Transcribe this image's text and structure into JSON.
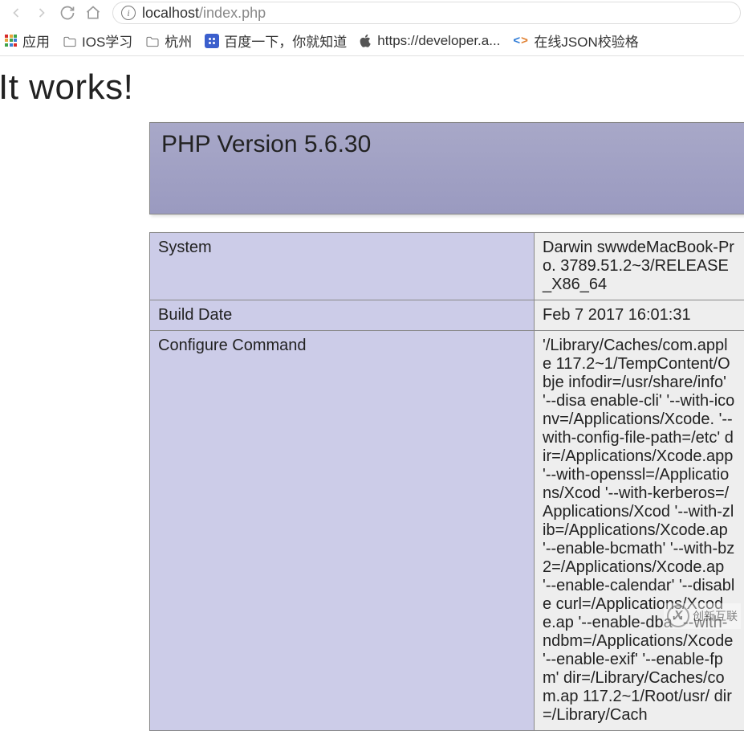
{
  "url": {
    "host": "localhost",
    "path": "/index.php"
  },
  "bookmarks": {
    "apps": "应用",
    "ios": "IOS学习",
    "hz": "杭州",
    "baidu": "百度一下，你就知道",
    "apple": "https://developer.a...",
    "json": "在线JSON校验格"
  },
  "page": {
    "heading": "It works!"
  },
  "phpinfo": {
    "title": "PHP Version 5.6.30",
    "rows": [
      {
        "label": "System",
        "value": "Darwin swwdeMacBook-Pro. 3789.51.2~3/RELEASE_X86_64"
      },
      {
        "label": "Build Date",
        "value": "Feb 7 2017 16:01:31"
      },
      {
        "label": "Configure Command",
        "value": "'/Library/Caches/com.apple 117.2~1/TempContent/Obje infodir=/usr/share/info' '--disa enable-cli' '--with-iconv=/Applications/Xcode. '--with-config-file-path=/etc' dir=/Applications/Xcode.app '--with-openssl=/Applications/Xcod '--with-kerberos=/Applications/Xcod '--with-zlib=/Applications/Xcode.ap '--enable-bcmath' '--with-bz2=/Applications/Xcode.ap '--enable-calendar' '--disable curl=/Applications/Xcode.ap '--enable-dba' '--with-ndbm=/Applications/Xcode '--enable-exif' '--enable-fpm' dir=/Library/Caches/com.ap 117.2~1/Root/usr/ dir=/Library/Cach"
      }
    ]
  },
  "watermark": {
    "symbol": "X",
    "text": "创新互联"
  }
}
